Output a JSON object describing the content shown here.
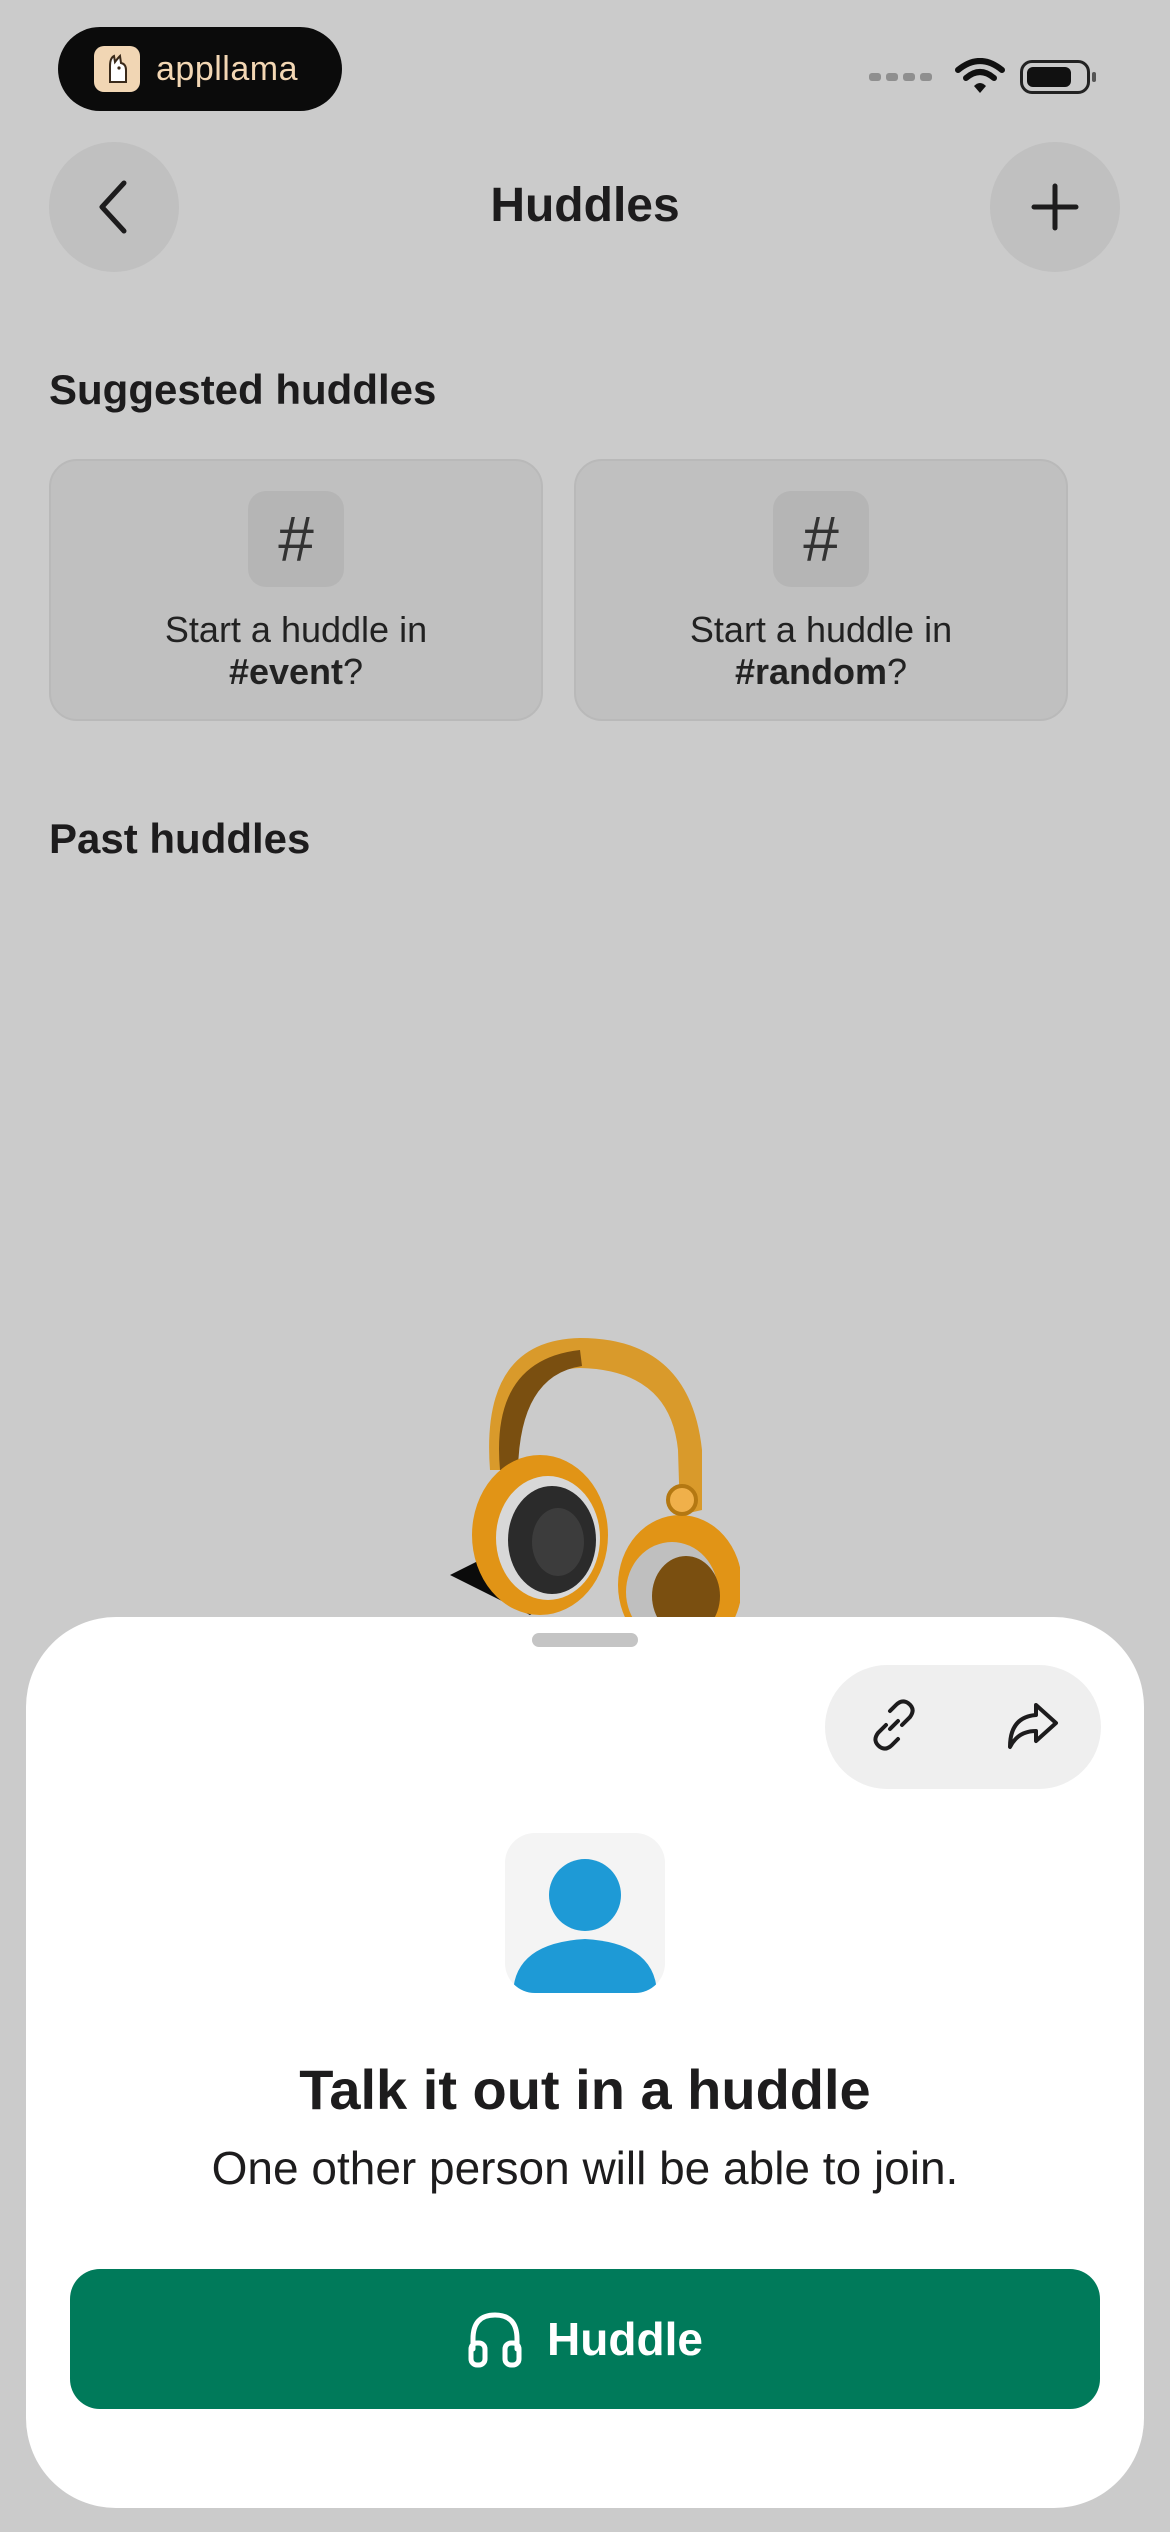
{
  "status_bar": {
    "brand_name": "appllama"
  },
  "header": {
    "title": "Huddles"
  },
  "suggested": {
    "title": "Suggested huddles",
    "cards": [
      {
        "icon": "#",
        "prefix": "Start a huddle in",
        "channel": "#event",
        "suffix": "?"
      },
      {
        "icon": "#",
        "prefix": "Start a huddle in",
        "channel": "#random",
        "suffix": "?"
      }
    ]
  },
  "past": {
    "title": "Past huddles"
  },
  "sheet": {
    "title": "Talk it out in a huddle",
    "subtitle": "One other person will be able to join.",
    "button_label": "Huddle"
  },
  "icons": {
    "back": "chevron-left-icon",
    "add": "plus-icon",
    "link": "link-icon",
    "share": "share-arrow-icon",
    "headphones": "headphones-icon",
    "avatar": "person-icon"
  },
  "colors": {
    "accent": "#007a5a",
    "avatar": "#1e9ad6",
    "illustration": "#e29b1f"
  }
}
